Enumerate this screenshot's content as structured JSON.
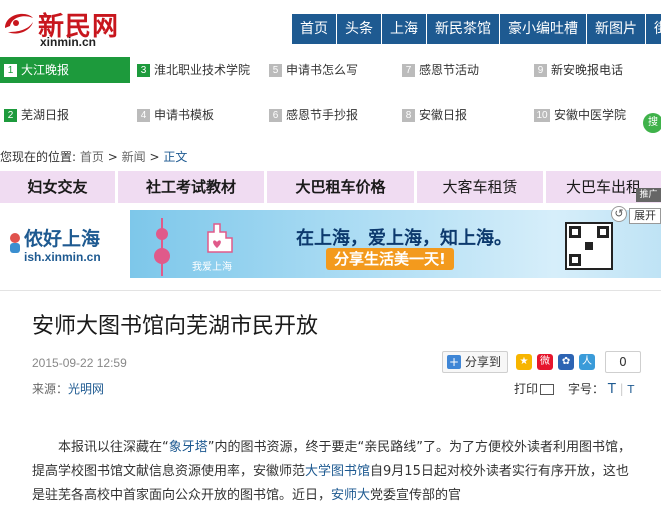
{
  "header": {
    "logo_cn": "新民网",
    "logo_en": "xinmin.cn",
    "nav": [
      "首页",
      "头条",
      "上海",
      "新民茶馆",
      "豪小编吐槽",
      "新图片",
      "街"
    ]
  },
  "links": [
    {
      "num": "1",
      "label": "大江晚报"
    },
    {
      "num": "3",
      "label": "淮北职业技术学院"
    },
    {
      "num": "5",
      "label": "申请书怎么写"
    },
    {
      "num": "7",
      "label": "感恩节活动"
    },
    {
      "num": "9",
      "label": "新安晚报电话"
    },
    {
      "num": "2",
      "label": "芜湖日报"
    },
    {
      "num": "4",
      "label": "申请书模板"
    },
    {
      "num": "6",
      "label": "感恩节手抄报"
    },
    {
      "num": "8",
      "label": "安徽日报"
    },
    {
      "num": "10",
      "label": "安徽中医学院"
    }
  ],
  "side_badge": "搜",
  "breadcrumb": {
    "prefix": "您现在的位置:",
    "home": "首页",
    "sep": ">",
    "news": "新闻",
    "current": "正文"
  },
  "adbar": [
    "妇女交友",
    "社工考试教材",
    "大巴租车价格",
    "大客车租赁",
    "大巴车出租"
  ],
  "adbar_tag": "推广",
  "banner": {
    "title": "侬好上海",
    "url": "ish.xinmin.cn",
    "slogan1": "在上海，爱上海，知上海。",
    "slogan2": "分享生活美一天!",
    "hand_text": "我爱上海",
    "expand": "展开",
    "refresh": "↺"
  },
  "article": {
    "title": "安师大图书馆向芜湖市民开放",
    "date": "2015-09-22 12:59",
    "source_label": "来源：",
    "source": "光明网",
    "share_label": "分享到",
    "share_count": "0",
    "print_label": "打印",
    "fontsize_label": "字号：",
    "fontsize_big": "T",
    "fontsize_sep": "|",
    "fontsize_small": "T",
    "p1": [
      {
        "t": "本报讯以往深藏在“"
      },
      {
        "t": "象牙塔",
        "link": true
      },
      {
        "t": "”内的图书资源，终于要走“亲民路线”了。为了方便校外读者利用图书馆，提高学校图书馆文献信息资源使用率，安徽师范"
      },
      {
        "t": "大学图书馆",
        "link": true
      },
      {
        "t": "自9月15日起对校外读者实行有序开放，这也是驻芜各高校中首家面向公众开放的图书馆。近日，"
      },
      {
        "t": "安师大",
        "link": true
      },
      {
        "t": "党委宣传部的官"
      }
    ]
  },
  "colors": {
    "brand_red": "#c8161d",
    "nav_blue": "#1e5a91",
    "link_green": "#1d9a3c",
    "adbar_purple": "#f0dcf2",
    "slogan_orange": "#f39a1d"
  }
}
